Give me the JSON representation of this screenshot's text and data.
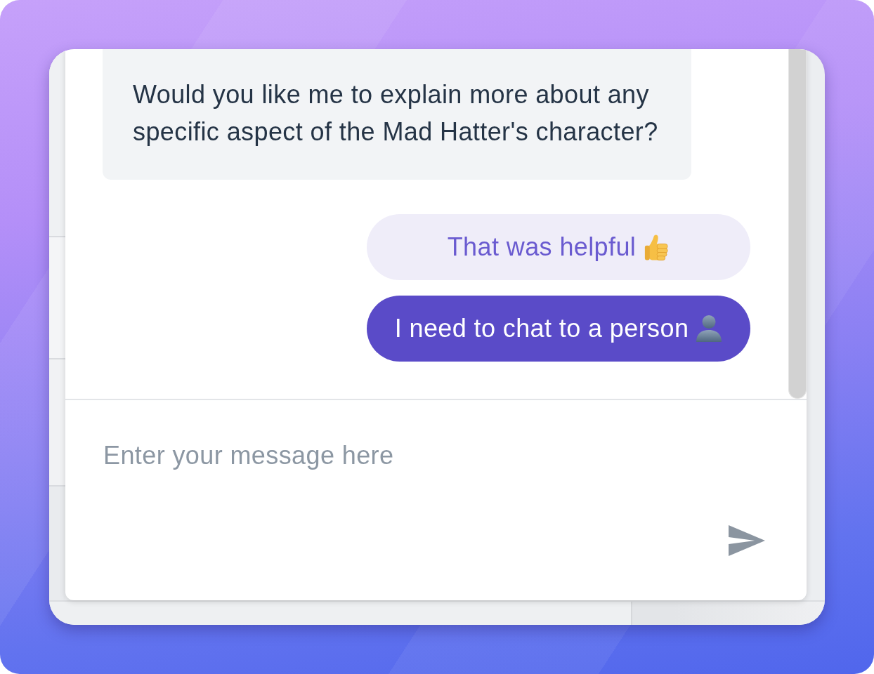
{
  "chat": {
    "messages": [
      {
        "kind": "incoming",
        "text": "Would you like me to explain more about any specific aspect of the Mad Hatter's character?"
      }
    ],
    "quick_replies": [
      {
        "label": "That was helpful",
        "kind": "feedback"
      },
      {
        "label": "I need to chat to a person",
        "kind": "handoff"
      }
    ],
    "composer": {
      "placeholder": "Enter your message here"
    }
  }
}
